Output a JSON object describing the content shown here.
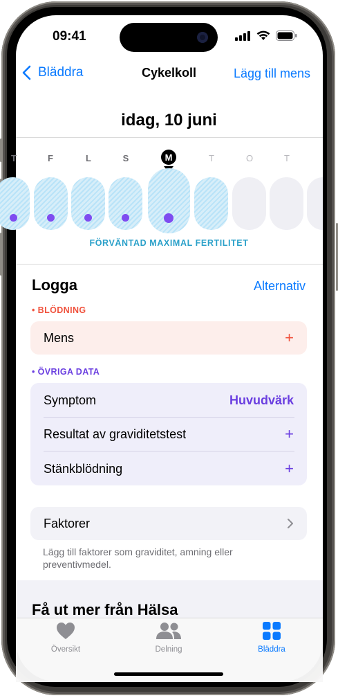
{
  "status": {
    "time": "09:41"
  },
  "nav": {
    "back_label": "Bläddra",
    "title": "Cykelkoll",
    "action": "Lägg till mens"
  },
  "calendar": {
    "date_title": "idag, 10 juni",
    "days": [
      "T",
      "F",
      "L",
      "S",
      "M",
      "T",
      "O",
      "T"
    ],
    "today_letter": "M",
    "fertility_label": "FÖRVÄNTAD MAXIMAL FERTILITET"
  },
  "log": {
    "title": "Logga",
    "options_label": "Alternativ",
    "bleeding": {
      "category": "BLÖDNING",
      "rows": [
        {
          "label": "Mens",
          "value": "+"
        }
      ]
    },
    "other": {
      "category": "ÖVRIGA DATA",
      "rows": [
        {
          "label": "Symptom",
          "value": "Huvudvärk"
        },
        {
          "label": "Resultat av graviditetstest",
          "value": "+"
        },
        {
          "label": "Stänkblödning",
          "value": "+"
        }
      ]
    },
    "factors": {
      "label": "Faktorer",
      "footnote": "Lägg till faktorer som graviditet, amning eller preventivmedel."
    }
  },
  "promo": {
    "title": "Få ut mer från Hälsa"
  },
  "tabs": [
    {
      "label": "Översikt",
      "icon": "heart-icon",
      "selected": false
    },
    {
      "label": "Delning",
      "icon": "people-icon",
      "selected": false
    },
    {
      "label": "Bläddra",
      "icon": "grid-icon",
      "selected": true
    }
  ],
  "colors": {
    "accent": "#0a7aff",
    "bleeding": "#f0523d",
    "bleeding_card": "#fdeeeb",
    "other_data": "#6a3ee0",
    "other_card": "#efeefa",
    "fertile": "#2aa0c9",
    "dot": "#7e4cf0"
  }
}
